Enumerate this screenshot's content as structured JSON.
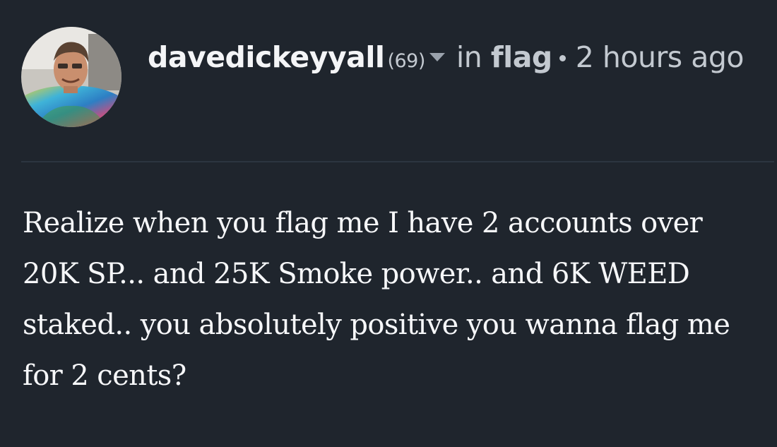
{
  "post": {
    "author": "davedickeyyall",
    "reputation": "(69)",
    "in_label": "in",
    "category": "flag",
    "timestamp": "2 hours ago",
    "body": "Realize when you flag me I have 2 accounts over 20K SP... and 25K Smoke power.. and 6K WEED staked.. you absolutely positive you wanna flag me for 2 cents?"
  },
  "colors": {
    "background": "#1f252d",
    "text_primary": "#f4f5f7",
    "text_secondary": "#c3c9d0",
    "divider": "#2c3540"
  }
}
